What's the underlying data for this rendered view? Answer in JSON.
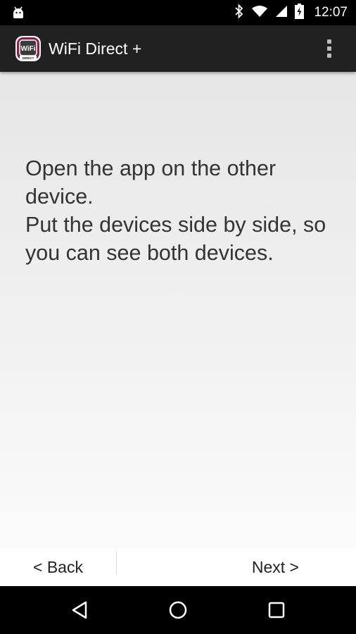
{
  "status_bar": {
    "time": "12:07",
    "icons": [
      "android-debug-icon",
      "bluetooth-icon",
      "wifi-icon",
      "cell-signal-icon",
      "battery-charging-icon"
    ]
  },
  "app_bar": {
    "title": "WiFi Direct +",
    "icon_text_top": "WiFi",
    "icon_text_bottom": "DIRECT",
    "background_color": "#212121"
  },
  "main": {
    "instruction_lines": [
      "Open the app on the other device.",
      "Put the devices side by side, so you can see both devices."
    ]
  },
  "buttons": {
    "back_label": "< Back",
    "next_label": "Next >"
  },
  "nav_bar": {
    "icons": [
      "back-triangle-icon",
      "home-circle-icon",
      "recents-square-icon"
    ]
  }
}
